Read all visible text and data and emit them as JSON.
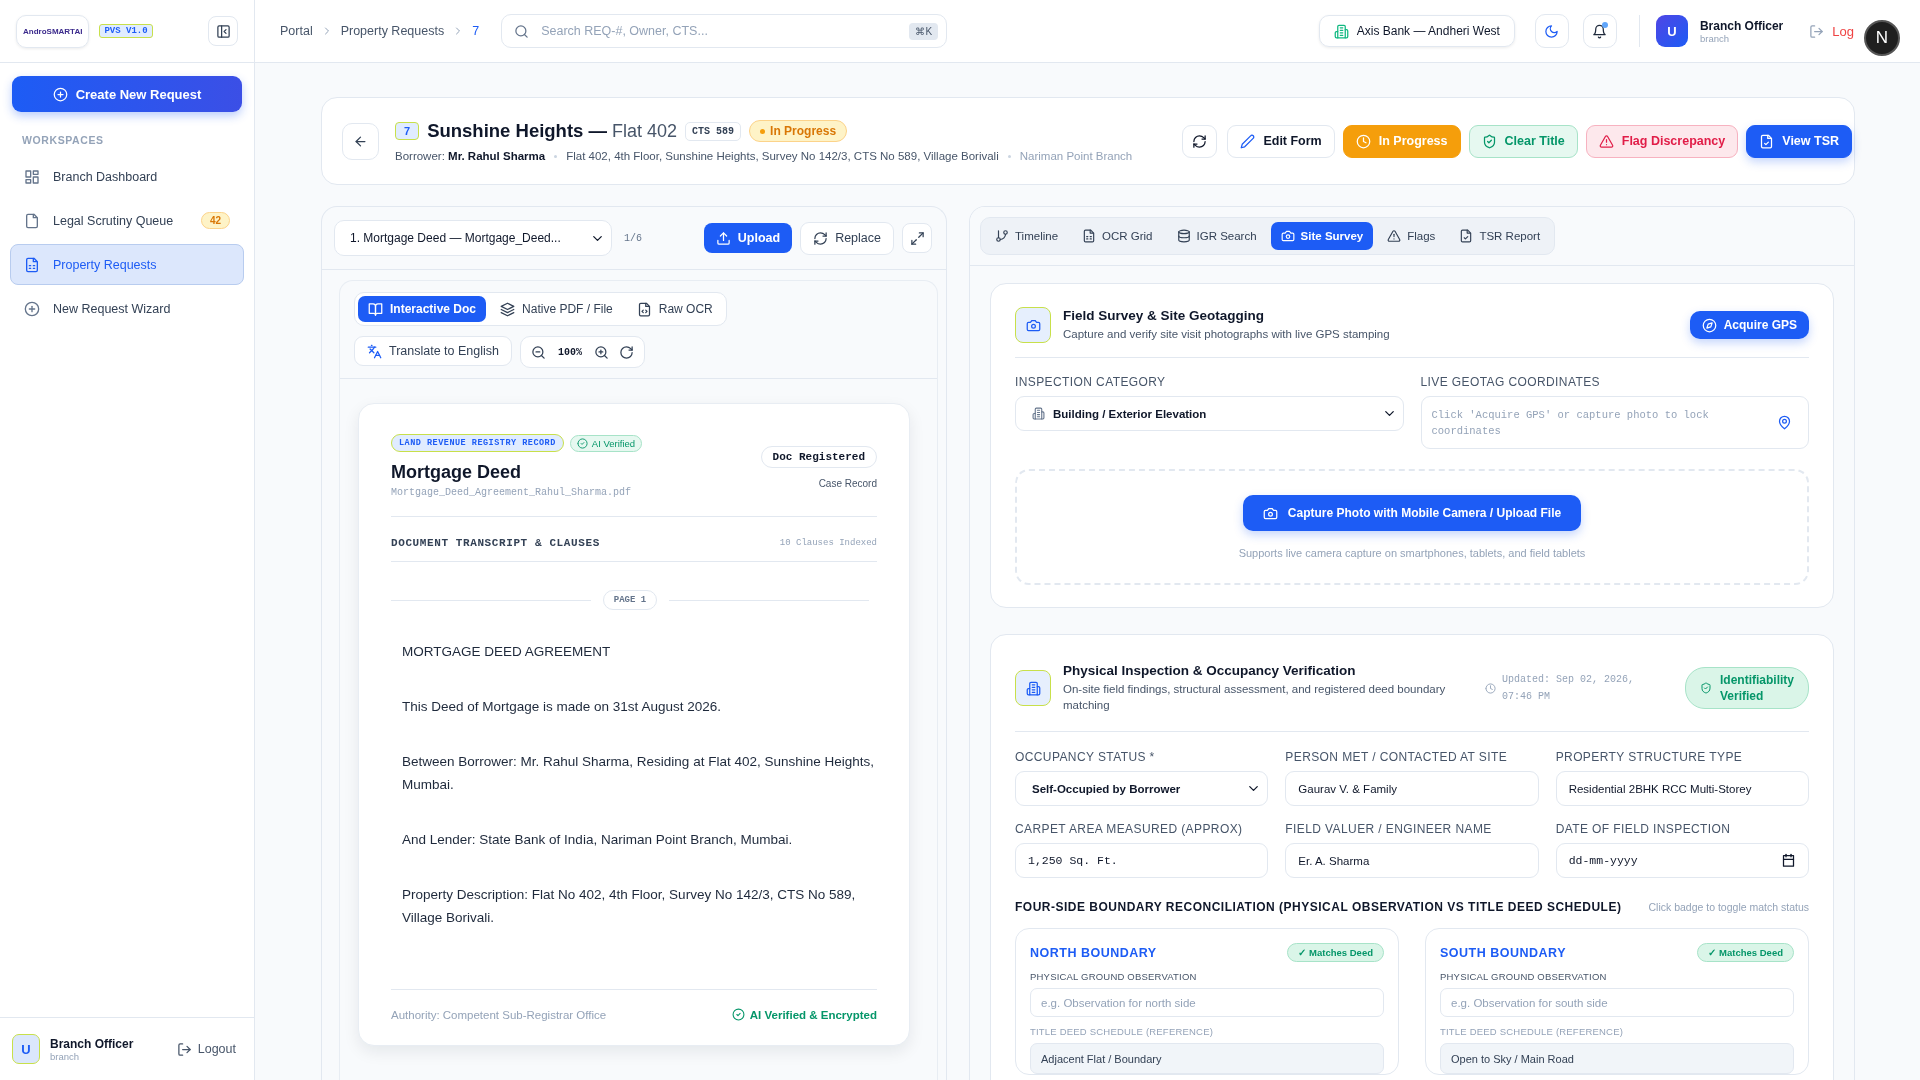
{
  "sidebar": {
    "logo": "AndroSMARTAI",
    "version": "PVS V1.0",
    "create_button": "Create New Request",
    "section": "WORKSPACES",
    "items": [
      {
        "label": "Branch Dashboard",
        "kind": "grid",
        "selected": false
      },
      {
        "label": "Legal Scrutiny Queue",
        "kind": "file",
        "badge": "42",
        "selected": false
      },
      {
        "label": "Property Requests",
        "kind": "filegrid",
        "selected": true
      },
      {
        "label": "New Request Wizard",
        "kind": "plus",
        "selected": false
      }
    ],
    "user": {
      "initial": "U",
      "name": "Branch Officer",
      "role": "branch"
    },
    "logout": "Logout"
  },
  "topbar": {
    "breadcrumbs": [
      "Portal",
      "Property Requests",
      "7"
    ],
    "search": {
      "placeholder": "Search REQ-#, Owner, CTS...",
      "shortcut": "⌘K"
    },
    "branch": "Axis Bank — Andheri West",
    "unread": true,
    "user": {
      "initial": "U",
      "name": "Branch Officer",
      "role": "branch"
    },
    "logout": "Log",
    "dev_badge": "N"
  },
  "request": {
    "id": "7",
    "title": "Sunshine Heights —",
    "unit": "Flat 402",
    "cts": "CTS 589",
    "status": "In Progress",
    "borrower_label": "Borrower:",
    "borrower": "Mr. Rahul Sharma",
    "address": "Flat 402, 4th Floor, Sunshine Heights, Survey No 142/3, CTS No 589, Village Borivali",
    "branch": "Nariman Point Branch",
    "actions": [
      {
        "kind": "refresh"
      },
      {
        "kind": "edit",
        "label": "Edit Form"
      },
      {
        "kind": "progress",
        "label": "In Progress"
      },
      {
        "kind": "clear",
        "label": "Clear Title"
      },
      {
        "kind": "flag",
        "label": "Flag Discrepancy"
      },
      {
        "kind": "tsr",
        "label": "View TSR"
      }
    ]
  },
  "document_panel": {
    "selector": "1. Mortgage Deed — Mortgage_Deed...",
    "count": "1/6",
    "upload": "Upload",
    "replace": "Replace",
    "view_tabs": [
      {
        "label": "Interactive Doc",
        "kind": "book",
        "selected": true
      },
      {
        "label": "Native PDF / File",
        "kind": "layers",
        "selected": false
      },
      {
        "label": "Raw OCR",
        "kind": "filecode",
        "selected": false
      }
    ],
    "translate": "Translate to English",
    "zoom": "100%",
    "document": {
      "category": "LAND REVENUE REGISTRY RECORD",
      "verified": "AI Verified",
      "title": "Mortgage Deed",
      "file": "Mortgage_Deed_Agreement_Rahul_Sharma.pdf",
      "registered": "Doc Registered",
      "record": "Case Record",
      "section": "DOCUMENT TRANSCRIPT & CLAUSES",
      "clauses": "10 Clauses Indexed",
      "page": "PAGE 1",
      "paragraphs": [
        "MORTGAGE DEED AGREEMENT",
        "This Deed of Mortgage is made on 31st August 2026.",
        "Between Borrower: Mr. Rahul Sharma, Residing at Flat 402, Sunshine Heights, Mumbai.",
        "And Lender: State Bank of India, Nariman Point Branch, Mumbai.",
        "Property Description: Flat No 402, 4th Floor, Survey No 142/3, CTS No 589, Village Borivali."
      ],
      "authority": "Authority: Competent Sub-Registrar Office",
      "footer_verified": "AI Verified & Encrypted"
    }
  },
  "tabs": [
    {
      "label": "Timeline",
      "kind": "branch",
      "selected": false
    },
    {
      "label": "OCR Grid",
      "kind": "filegrid",
      "selected": false
    },
    {
      "label": "IGR Search",
      "kind": "database",
      "selected": false
    },
    {
      "label": "Site Survey",
      "kind": "camera",
      "selected": true
    },
    {
      "label": "Flags",
      "kind": "warning",
      "selected": false
    },
    {
      "label": "TSR Report",
      "kind": "filecheck",
      "selected": false
    }
  ],
  "site_survey": {
    "title": "Field Survey & Site Geotagging",
    "subtitle": "Capture and verify site visit photographs with live GPS stamping",
    "gps_button": "Acquire GPS",
    "category_label": "INSPECTION CATEGORY",
    "category": "Building / Exterior Elevation",
    "geotag_label": "LIVE GEOTAG COORDINATES",
    "geotag_placeholder": "Click 'Acquire GPS' or capture photo to lock coordinates",
    "capture_button": "Capture Photo with Mobile Camera / Upload File",
    "capture_note": "Supports live camera capture on smartphones, tablets, and field tablets"
  },
  "inspection": {
    "title": "Physical Inspection & Occupancy Verification",
    "subtitle": "On-site field findings, structural assessment, and registered deed boundary matching",
    "updated": "Updated: Sep 02, 2026, 07:46 PM",
    "badge": "Identifiability Verified",
    "fields": [
      {
        "label": "OCCUPANCY STATUS *",
        "kind": "select",
        "value": "Self-Occupied by Borrower"
      },
      {
        "label": "PERSON MET / CONTACTED AT SITE",
        "kind": "text",
        "value": "Gaurav V. & Family"
      },
      {
        "label": "PROPERTY STRUCTURE TYPE",
        "kind": "text",
        "value": "Residential 2BHK RCC Multi-Storey"
      },
      {
        "label": "CARPET AREA MEASURED (APPROX)",
        "kind": "mono",
        "value": "1,250 Sq. Ft."
      },
      {
        "label": "FIELD VALUER / ENGINEER NAME",
        "kind": "text",
        "value": "Er. A. Sharma"
      },
      {
        "label": "DATE OF FIELD INSPECTION",
        "kind": "date",
        "placeholder": "dd-mm-yyyy"
      }
    ],
    "boundary_title": "FOUR-SIDE BOUNDARY RECONCILIATION (PHYSICAL OBSERVATION VS TITLE DEED SCHEDULE)",
    "boundary_hint": "Click badge to toggle match status",
    "boundaries": [
      {
        "side": "NORTH BOUNDARY",
        "status": "✓ Matches Deed",
        "matched": true,
        "observation_label": "PHYSICAL GROUND OBSERVATION",
        "observation_placeholder": "e.g. Observation for north side",
        "reference_label": "TITLE DEED SCHEDULE (REFERENCE)",
        "reference": "Adjacent Flat / Boundary"
      },
      {
        "side": "SOUTH BOUNDARY",
        "status": "✓ Matches Deed",
        "matched": true,
        "observation_label": "PHYSICAL GROUND OBSERVATION",
        "observation_placeholder": "e.g. Observation for south side",
        "reference_label": "TITLE DEED SCHEDULE (REFERENCE)",
        "reference": "Open to Sky / Main Road"
      }
    ]
  }
}
